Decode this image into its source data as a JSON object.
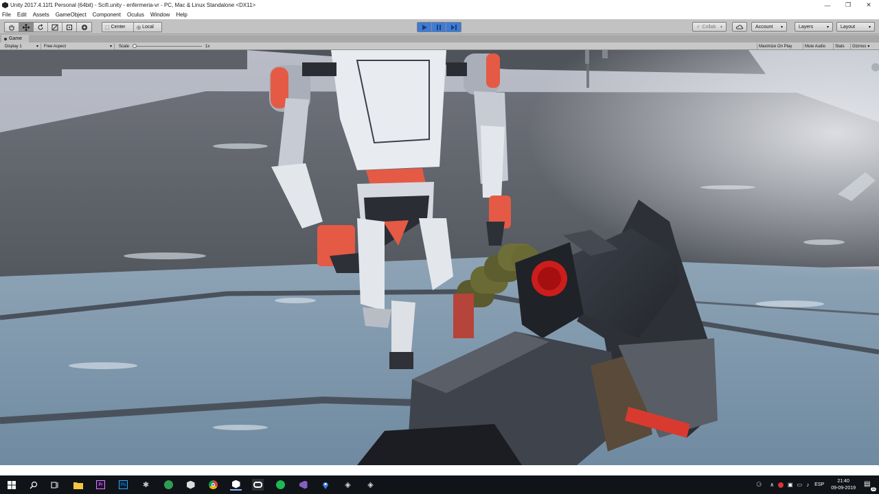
{
  "window": {
    "title": "Unity 2017.4.11f1 Personal (64bit) - Scifi.unity - enfermeria-vr - PC, Mac & Linux Standalone <DX11>",
    "controls": [
      "—",
      "❐",
      "✕"
    ]
  },
  "menu": [
    "File",
    "Edit",
    "Assets",
    "GameObject",
    "Component",
    "Oculus",
    "Window",
    "Help"
  ],
  "toolbar": {
    "pivot_center": "Center",
    "pivot_local": "Local",
    "collab": "Collab",
    "account": "Account",
    "layers": "Layers",
    "layout": "Layout"
  },
  "game_tab": {
    "label": "Game",
    "display": "Display 1",
    "aspect": "Free Aspect",
    "scale_label": "Scale",
    "scale_value": "1x",
    "maximize": "Maximize On Play",
    "mute": "Mute Audio",
    "stats": "Stats",
    "gizmos": "Gizmos"
  },
  "taskbar": {
    "lang": "ESP",
    "time": "21:40",
    "date": "09-09-2019",
    "notif_count": "32"
  },
  "colors": {
    "play_active": "#3d7bd6",
    "taskbar_bg": "#101418"
  }
}
